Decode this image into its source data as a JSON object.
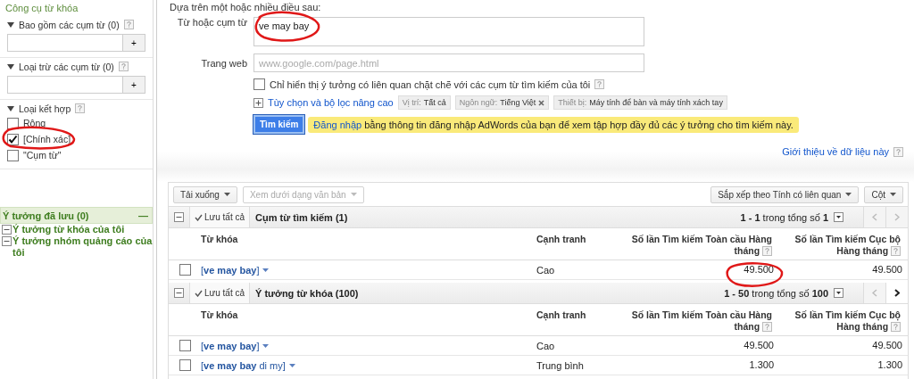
{
  "sidebar": {
    "title": "Công cụ từ khóa",
    "filters": [
      {
        "label": "Bao gồm các cụm từ (0)",
        "expanded": true,
        "button": "+"
      },
      {
        "label": "Loại trừ các cụm từ (0)",
        "expanded": true,
        "button": "+"
      }
    ],
    "match_types": {
      "label": "Loại kết hợp",
      "expanded": true,
      "options": [
        {
          "label": "Rộng",
          "checked": false
        },
        {
          "label": "[Chính xác]",
          "checked": true
        },
        {
          "label": "\"Cụm từ\"",
          "checked": false
        }
      ]
    },
    "saved_ideas": {
      "title": "Ý tưởng đã lưu (0)",
      "collapse": "—",
      "items": [
        {
          "label": "Ý tưởng từ khóa của tôi",
          "expanded": true
        },
        {
          "label": "Ý tưởng nhóm quảng cáo của tôi",
          "expanded": true
        }
      ]
    }
  },
  "search_form": {
    "intro": "Dựa trên một hoặc nhiều điều sau:",
    "fields": [
      {
        "label": "Từ hoặc cụm từ",
        "value": "ve may bay"
      },
      {
        "label": "Trang web",
        "placeholder": "www.google.com/page.html"
      }
    ],
    "closely_related": {
      "label": "Chỉ hiển thị ý tưởng có liên quan chặt chẽ với các cụm từ tìm kiếm của tôi",
      "checked": false
    },
    "advanced": {
      "label": "Tùy chọn và bộ lọc nâng cao",
      "expanded": false,
      "chips": [
        {
          "name": "Vị trí:",
          "value": "Tất cả",
          "removable": false
        },
        {
          "name": "Ngôn ngữ:",
          "value": "Tiếng Việt",
          "removable": true
        },
        {
          "name": "Thiết bị:",
          "value": "Máy tính để bàn và máy tính xách tay",
          "removable": false
        }
      ]
    },
    "search_button": "Tìm kiếm",
    "notice": {
      "link": "Đăng nhập",
      "text": "bằng thông tin đăng nhập AdWords của bạn để xem tập hợp đầy đủ các ý tưởng cho tìm kiếm này."
    },
    "about_link": "Giới thiệu về dữ liệu này"
  },
  "results": {
    "toolbar": {
      "download": "Tải xuống",
      "view_text": {
        "label": "Xem dưới dạng văn bản",
        "disabled": true
      },
      "sort": "Sắp xếp theo Tính có liên quan",
      "columns": "Cột"
    },
    "sections": [
      {
        "save_all": "Lưu tất cả",
        "title": "Cụm từ tìm kiếm (1)",
        "range": "**1 - 1** trong tổng số **1**",
        "prev_disabled": true,
        "next_disabled": true,
        "columns": [
          "Từ khóa",
          "Cạnh tranh",
          "Số lần Tìm kiếm Toàn cầu Hàng tháng",
          "Số lần Tìm kiếm Cục bộ Hàng tháng"
        ],
        "rows": [
          {
            "checked": false,
            "keyword": "[**ve may bay**]",
            "competition": "Cao",
            "global": "49.500",
            "local": "49.500"
          }
        ]
      },
      {
        "save_all": "Lưu tất cả",
        "title": "Ý tưởng từ khóa (100)",
        "range": "**1 - 50** trong tổng số **100**",
        "prev_disabled": true,
        "next_disabled": false,
        "columns": [
          "Từ khóa",
          "Cạnh tranh",
          "Số lần Tìm kiếm Toàn cầu Hàng tháng",
          "Số lần Tìm kiếm Cục bộ Hàng tháng"
        ],
        "rows": [
          {
            "checked": false,
            "keyword": "[**ve may bay**]",
            "competition": "Cao",
            "global": "49.500",
            "local": "49.500"
          },
          {
            "checked": false,
            "keyword": "[**ve may bay** di my]",
            "competition": "Trung bình",
            "global": "1.300",
            "local": "1.300"
          }
        ]
      }
    ]
  }
}
